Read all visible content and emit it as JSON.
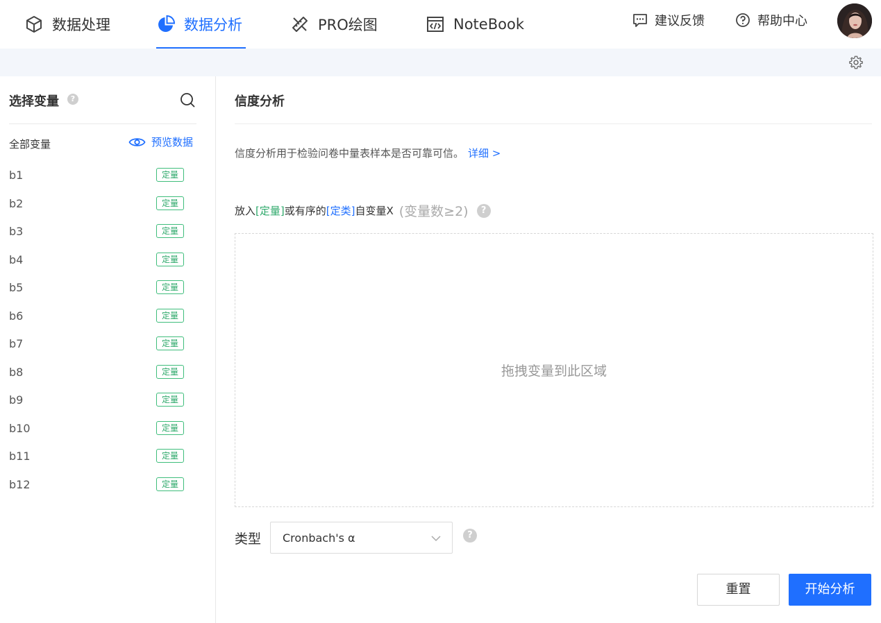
{
  "nav": {
    "tabs": [
      {
        "label": "数据处理",
        "icon": "cube-icon"
      },
      {
        "label": "数据分析",
        "icon": "pie-chart-icon",
        "active": true
      },
      {
        "label": "PRO绘图",
        "icon": "ruler-pencil-icon"
      },
      {
        "label": "NoteBook",
        "icon": "code-window-icon"
      }
    ],
    "feedback_label": "建议反馈",
    "help_label": "帮助中心"
  },
  "sidebar": {
    "title": "选择变量",
    "all_vars_label": "全部变量",
    "preview_label": "预览数据",
    "variables": [
      {
        "name": "b1",
        "type": "定量"
      },
      {
        "name": "b2",
        "type": "定量"
      },
      {
        "name": "b3",
        "type": "定量"
      },
      {
        "name": "b4",
        "type": "定量"
      },
      {
        "name": "b5",
        "type": "定量"
      },
      {
        "name": "b6",
        "type": "定量"
      },
      {
        "name": "b7",
        "type": "定量"
      },
      {
        "name": "b8",
        "type": "定量"
      },
      {
        "name": "b9",
        "type": "定量"
      },
      {
        "name": "b10",
        "type": "定量"
      },
      {
        "name": "b11",
        "type": "定量"
      },
      {
        "name": "b12",
        "type": "定量"
      }
    ]
  },
  "main": {
    "title": "信度分析",
    "description": "信度分析用于检验问卷中量表样本是否可靠可信。",
    "detail_link": "详细 >",
    "instruction": {
      "prefix": "放入 ",
      "quant": "[定量]",
      "middle": " 或有序的 ",
      "categ": "[定类]",
      "suffix": " 自变量X",
      "hint": "(变量数≥2)"
    },
    "dropzone_text": "拖拽变量到此区域",
    "type_label": "类型",
    "type_value": "Cronbach's α",
    "reset_label": "重置",
    "start_label": "开始分析"
  },
  "colors": {
    "accent": "#1f6fff",
    "quant_green": "#2fa96b",
    "subbar_bg": "#f3f6fb"
  }
}
